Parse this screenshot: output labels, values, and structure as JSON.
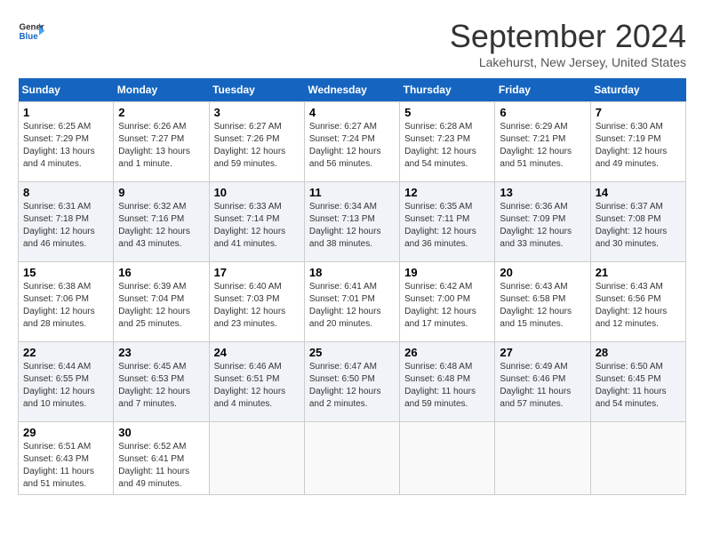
{
  "header": {
    "logo_general": "General",
    "logo_blue": "Blue",
    "month_title": "September 2024",
    "location": "Lakehurst, New Jersey, United States"
  },
  "calendar": {
    "days_of_week": [
      "Sunday",
      "Monday",
      "Tuesday",
      "Wednesday",
      "Thursday",
      "Friday",
      "Saturday"
    ],
    "weeks": [
      [
        {
          "num": "1",
          "sunrise": "6:25 AM",
          "sunset": "7:29 PM",
          "daylight": "13 hours and 4 minutes."
        },
        {
          "num": "2",
          "sunrise": "6:26 AM",
          "sunset": "7:27 PM",
          "daylight": "13 hours and 1 minute."
        },
        {
          "num": "3",
          "sunrise": "6:27 AM",
          "sunset": "7:26 PM",
          "daylight": "12 hours and 59 minutes."
        },
        {
          "num": "4",
          "sunrise": "6:27 AM",
          "sunset": "7:24 PM",
          "daylight": "12 hours and 56 minutes."
        },
        {
          "num": "5",
          "sunrise": "6:28 AM",
          "sunset": "7:23 PM",
          "daylight": "12 hours and 54 minutes."
        },
        {
          "num": "6",
          "sunrise": "6:29 AM",
          "sunset": "7:21 PM",
          "daylight": "12 hours and 51 minutes."
        },
        {
          "num": "7",
          "sunrise": "6:30 AM",
          "sunset": "7:19 PM",
          "daylight": "12 hours and 49 minutes."
        }
      ],
      [
        {
          "num": "8",
          "sunrise": "6:31 AM",
          "sunset": "7:18 PM",
          "daylight": "12 hours and 46 minutes."
        },
        {
          "num": "9",
          "sunrise": "6:32 AM",
          "sunset": "7:16 PM",
          "daylight": "12 hours and 43 minutes."
        },
        {
          "num": "10",
          "sunrise": "6:33 AM",
          "sunset": "7:14 PM",
          "daylight": "12 hours and 41 minutes."
        },
        {
          "num": "11",
          "sunrise": "6:34 AM",
          "sunset": "7:13 PM",
          "daylight": "12 hours and 38 minutes."
        },
        {
          "num": "12",
          "sunrise": "6:35 AM",
          "sunset": "7:11 PM",
          "daylight": "12 hours and 36 minutes."
        },
        {
          "num": "13",
          "sunrise": "6:36 AM",
          "sunset": "7:09 PM",
          "daylight": "12 hours and 33 minutes."
        },
        {
          "num": "14",
          "sunrise": "6:37 AM",
          "sunset": "7:08 PM",
          "daylight": "12 hours and 30 minutes."
        }
      ],
      [
        {
          "num": "15",
          "sunrise": "6:38 AM",
          "sunset": "7:06 PM",
          "daylight": "12 hours and 28 minutes."
        },
        {
          "num": "16",
          "sunrise": "6:39 AM",
          "sunset": "7:04 PM",
          "daylight": "12 hours and 25 minutes."
        },
        {
          "num": "17",
          "sunrise": "6:40 AM",
          "sunset": "7:03 PM",
          "daylight": "12 hours and 23 minutes."
        },
        {
          "num": "18",
          "sunrise": "6:41 AM",
          "sunset": "7:01 PM",
          "daylight": "12 hours and 20 minutes."
        },
        {
          "num": "19",
          "sunrise": "6:42 AM",
          "sunset": "7:00 PM",
          "daylight": "12 hours and 17 minutes."
        },
        {
          "num": "20",
          "sunrise": "6:43 AM",
          "sunset": "6:58 PM",
          "daylight": "12 hours and 15 minutes."
        },
        {
          "num": "21",
          "sunrise": "6:43 AM",
          "sunset": "6:56 PM",
          "daylight": "12 hours and 12 minutes."
        }
      ],
      [
        {
          "num": "22",
          "sunrise": "6:44 AM",
          "sunset": "6:55 PM",
          "daylight": "12 hours and 10 minutes."
        },
        {
          "num": "23",
          "sunrise": "6:45 AM",
          "sunset": "6:53 PM",
          "daylight": "12 hours and 7 minutes."
        },
        {
          "num": "24",
          "sunrise": "6:46 AM",
          "sunset": "6:51 PM",
          "daylight": "12 hours and 4 minutes."
        },
        {
          "num": "25",
          "sunrise": "6:47 AM",
          "sunset": "6:50 PM",
          "daylight": "12 hours and 2 minutes."
        },
        {
          "num": "26",
          "sunrise": "6:48 AM",
          "sunset": "6:48 PM",
          "daylight": "11 hours and 59 minutes."
        },
        {
          "num": "27",
          "sunrise": "6:49 AM",
          "sunset": "6:46 PM",
          "daylight": "11 hours and 57 minutes."
        },
        {
          "num": "28",
          "sunrise": "6:50 AM",
          "sunset": "6:45 PM",
          "daylight": "11 hours and 54 minutes."
        }
      ],
      [
        {
          "num": "29",
          "sunrise": "6:51 AM",
          "sunset": "6:43 PM",
          "daylight": "11 hours and 51 minutes."
        },
        {
          "num": "30",
          "sunrise": "6:52 AM",
          "sunset": "6:41 PM",
          "daylight": "11 hours and 49 minutes."
        },
        null,
        null,
        null,
        null,
        null
      ]
    ]
  }
}
